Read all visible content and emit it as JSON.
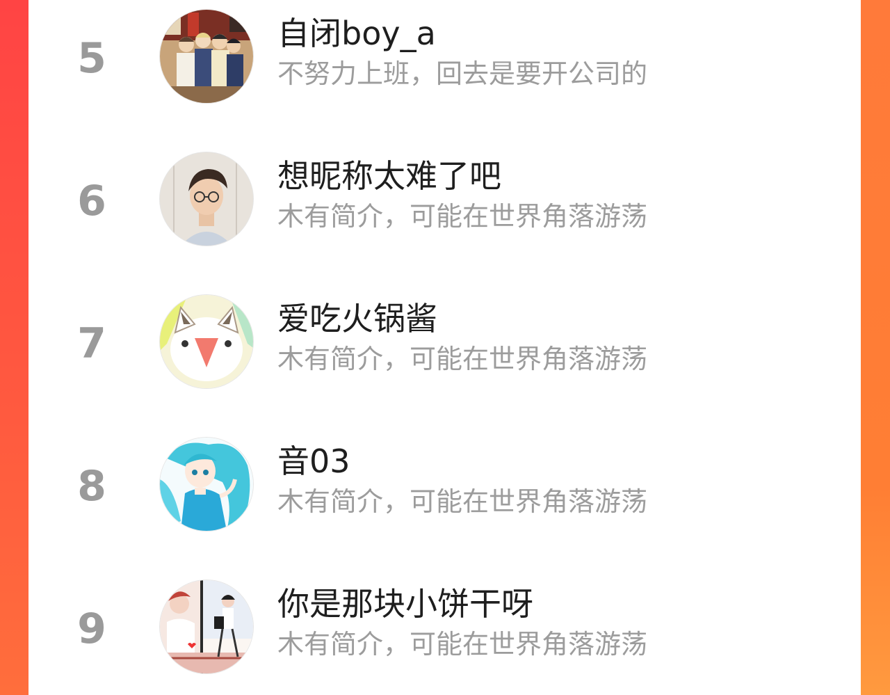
{
  "ranking": {
    "items": [
      {
        "rank": "5",
        "name": "自闭boy_a",
        "bio": "不努力上班，回去是要开公司的",
        "avatar": "anime-group-avatar"
      },
      {
        "rank": "6",
        "name": "想昵称太难了吧",
        "bio": "木有简介，可能在世界角落游荡",
        "avatar": "man-portrait-avatar"
      },
      {
        "rank": "7",
        "name": "爱吃火锅酱",
        "bio": "木有简介，可能在世界角落游荡",
        "avatar": "cartoon-cat-avatar"
      },
      {
        "rank": "8",
        "name": "音03",
        "bio": "木有简介，可能在世界角落游荡",
        "avatar": "anime-blue-hair-girl-avatar"
      },
      {
        "rank": "9",
        "name": "你是那块小饼干呀",
        "bio": "木有简介，可能在世界角落游荡",
        "avatar": "illustrated-couple-avatar"
      }
    ]
  },
  "colors": {
    "side_left": "#ff4a45",
    "side_right": "#ff7e34",
    "panel": "#ffffff",
    "rank_text": "#9a9a9a",
    "name_text": "#1e1e1e",
    "bio_text": "#9c9c9c"
  }
}
